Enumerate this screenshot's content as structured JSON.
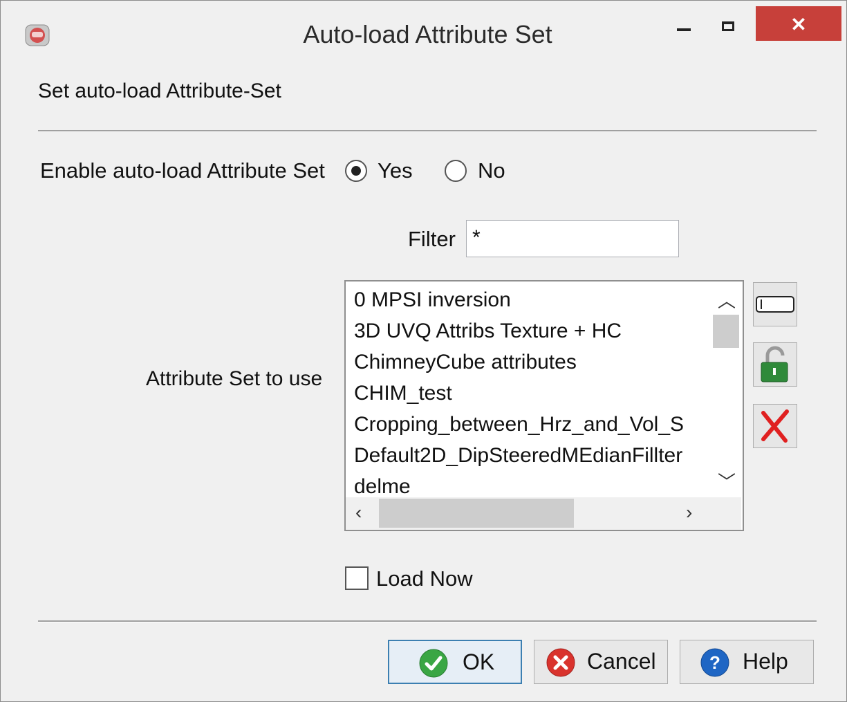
{
  "window": {
    "title": "Auto-load Attribute Set",
    "close_symbol": "✕"
  },
  "section": {
    "label": "Set auto-load Attribute-Set"
  },
  "enable": {
    "label": "Enable auto-load Attribute Set",
    "yes_label": "Yes",
    "no_label": "No",
    "selected": "Yes"
  },
  "filter": {
    "label": "Filter",
    "value": "*"
  },
  "attribute_set": {
    "label": "Attribute Set to use",
    "items": [
      "0 MPSI inversion",
      "3D UVQ Attribs Texture + HC",
      "ChimneyCube attributes",
      "CHIM_test",
      "Cropping_between_Hrz_and_Vol_S",
      "Default2D_DipSteeredMEdianFillter",
      "delme"
    ]
  },
  "side_buttons": [
    "rename-icon",
    "unlock-icon",
    "delete-icon"
  ],
  "load_now": {
    "label": "Load Now",
    "checked": false
  },
  "buttons": {
    "ok": "OK",
    "cancel": "Cancel",
    "help": "Help"
  },
  "colors": {
    "close_red": "#c7403a",
    "ok_green": "#3aa644",
    "cancel_red": "#d9332d",
    "help_blue": "#1f66c4",
    "delete_red": "#e02020"
  }
}
